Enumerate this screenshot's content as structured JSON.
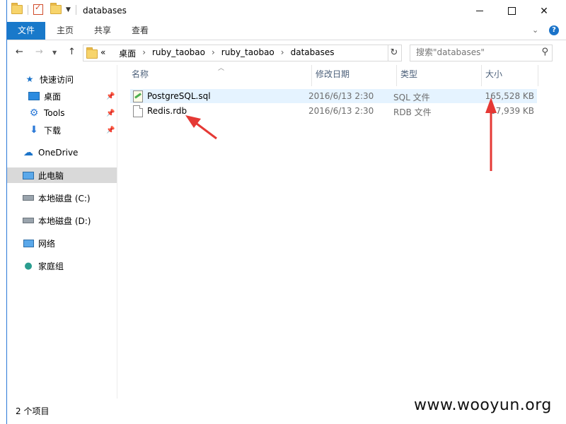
{
  "window": {
    "title": "databases"
  },
  "ribbon": {
    "tabs": [
      "文件",
      "主页",
      "共享",
      "查看"
    ]
  },
  "address": {
    "prefix": "«",
    "crumbs": [
      "桌面",
      "ruby_taobao",
      "ruby_taobao",
      "databases"
    ]
  },
  "search": {
    "placeholder": "搜索\"databases\""
  },
  "navpane": {
    "quick_access": "快速访问",
    "items": [
      {
        "label": "桌面",
        "icon": "desktop-icon",
        "pinned": true
      },
      {
        "label": "Tools",
        "icon": "gear-icon",
        "pinned": true
      },
      {
        "label": "下载",
        "icon": "download-icon",
        "pinned": true
      }
    ],
    "onedrive": "OneDrive",
    "this_pc": "此电脑",
    "drive_c": "本地磁盘 (C:)",
    "drive_d": "本地磁盘 (D:)",
    "network": "网络",
    "homegroup": "家庭组"
  },
  "columns": {
    "name": "名称",
    "date": "修改日期",
    "type": "类型",
    "size": "大小"
  },
  "files": [
    {
      "name": "PostgreSQL.sql",
      "date": "2016/6/13 2:30",
      "type": "SQL 文件",
      "size": "165,528 KB",
      "icon": "sql-file-icon"
    },
    {
      "name": "Redis.rdb",
      "date": "2016/6/13 2:30",
      "type": "RDB 文件",
      "size": "67,939 KB",
      "icon": "file-icon"
    }
  ],
  "status": {
    "count": "2 个项目"
  },
  "watermark": "www.wooyun.org",
  "colors": {
    "accent": "#1979ca",
    "annotation": "#e53935",
    "highlight_row": "#e5f3ff"
  }
}
